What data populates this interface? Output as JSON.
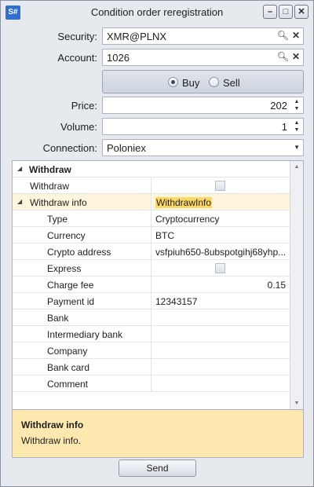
{
  "window": {
    "app_icon": "S#",
    "title": "Condition order reregistration"
  },
  "form": {
    "security_label": "Security:",
    "security_value": "XMR@PLNX",
    "account_label": "Account:",
    "account_value": "1026",
    "side": {
      "buy_label": "Buy",
      "sell_label": "Sell",
      "selected": "Buy"
    },
    "price_label": "Price:",
    "price_value": "202",
    "volume_label": "Volume:",
    "volume_value": "1",
    "connection_label": "Connection:",
    "connection_value": "Poloniex"
  },
  "grid": {
    "category": "Withdraw",
    "withdraw_label": "Withdraw",
    "info": {
      "label": "Withdraw info",
      "value": "WithdrawInfo"
    },
    "props": {
      "type": {
        "label": "Type",
        "value": "Cryptocurrency"
      },
      "currency": {
        "label": "Currency",
        "value": "BTC"
      },
      "crypto_address": {
        "label": "Crypto address",
        "value": "vsfpiuh650-8ubspotgihj68yhp..."
      },
      "express": {
        "label": "Express"
      },
      "charge_fee": {
        "label": "Charge fee",
        "value": "0.15"
      },
      "payment_id": {
        "label": "Payment id",
        "value": "12343157"
      },
      "bank": {
        "label": "Bank"
      },
      "intermediary_bank": {
        "label": "Intermediary bank"
      },
      "company": {
        "label": "Company"
      },
      "bank_card": {
        "label": "Bank card"
      },
      "comment": {
        "label": "Comment"
      }
    }
  },
  "description": {
    "title": "Withdraw info",
    "text": "Withdraw info."
  },
  "send_label": "Send",
  "icons": {
    "lookup": "search-icon",
    "clear": "close-icon",
    "collapse": "expander-icon"
  },
  "colors": {
    "selected_row": "#fdf6dc",
    "highlight": "#ffd966",
    "description_bg": "#fde9b0",
    "app_icon": "#2e6fd1"
  }
}
